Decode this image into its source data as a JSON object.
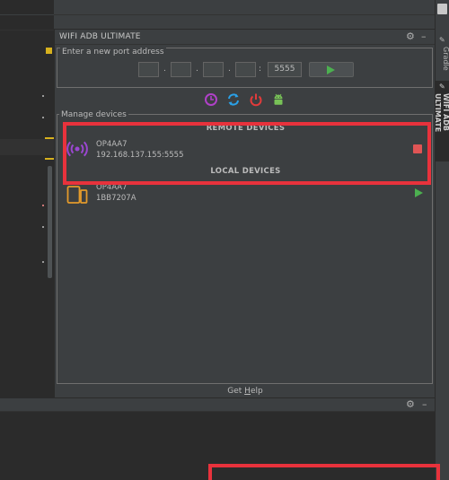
{
  "panel": {
    "title": "WIFI ADB ULTIMATE",
    "settings_icon": "gear-icon",
    "minimize_icon": "minimize-icon"
  },
  "port_form": {
    "legend": "Enter a new port address",
    "ip_parts": [
      "",
      "",
      "",
      ""
    ],
    "dot": ".",
    "colon": ":",
    "port": "5555",
    "connect_icon": "play-icon"
  },
  "toolbar": {
    "icons": [
      "history-icon",
      "refresh-icon",
      "power-icon",
      "android-icon"
    ],
    "colors": {
      "history": "#b041c8",
      "refresh": "#2aa1e8",
      "power": "#e23b3b",
      "android": "#78c257"
    }
  },
  "devices": {
    "legend": "Manage devices",
    "remote_title": "REMOTE DEVICES",
    "local_title": "LOCAL DEVICES",
    "remote": {
      "name": "OP4AA7",
      "address": "192.168.137.155:5555",
      "icon": "wifi-signal-icon",
      "action_icon": "stop-icon"
    },
    "local": {
      "name": "OP4AA7",
      "serial": "1BB7207A",
      "icon": "phone-icon",
      "action_icon": "play-icon"
    }
  },
  "help": {
    "pre": "Get ",
    "mnemonic": "H",
    "post": "elp"
  },
  "right_tabs": {
    "gradle": "Gradle",
    "wifi": "WIFI ADB ULTIMATE"
  },
  "colors": {
    "highlight": "#e8323c",
    "accent_green": "#4cb050",
    "stop_red": "#e05555"
  }
}
